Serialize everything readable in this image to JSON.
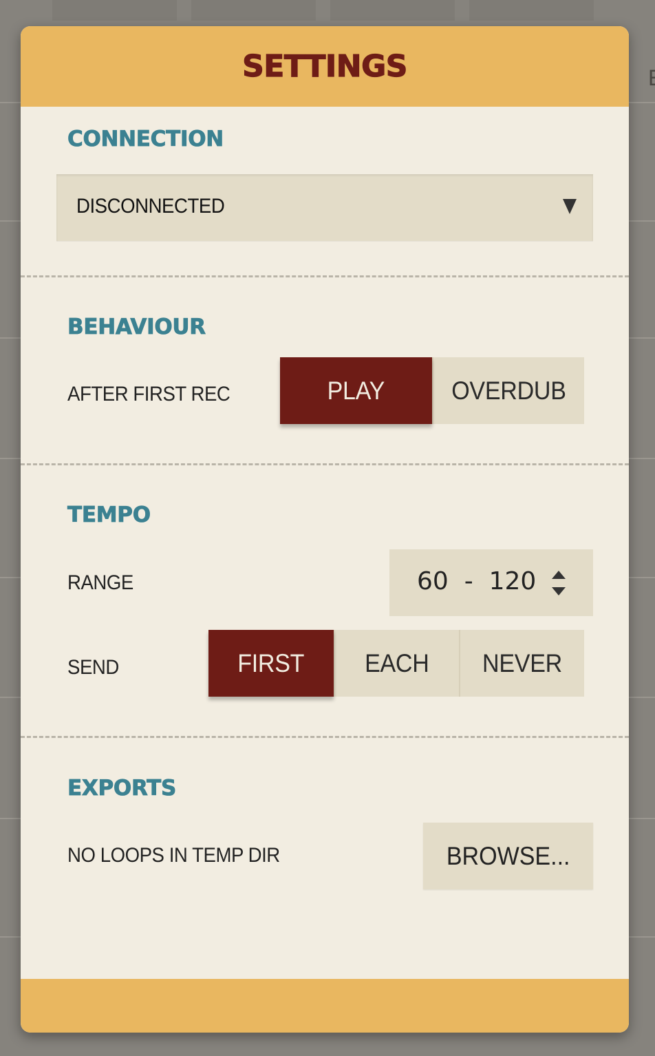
{
  "colors": {
    "header_bg": "#e9b760",
    "title": "#6e1c16",
    "section_title": "#3b8191",
    "panel_bg": "#f2ede1",
    "control_bg": "#e3dcc8",
    "active_bg": "#6e1c16"
  },
  "header": {
    "title": "SETTINGS"
  },
  "connection": {
    "section_title": "CONNECTION",
    "select_value": "DISCONNECTED",
    "caret_icon": "chevron-down-icon"
  },
  "behaviour": {
    "section_title": "BEHAVIOUR",
    "after_first_rec_label": "AFTER FIRST REC",
    "options": [
      "PLAY",
      "OVERDUB"
    ],
    "selected": "PLAY"
  },
  "tempo": {
    "section_title": "TEMPO",
    "range_label": "RANGE",
    "range_value": "60  -  120",
    "send_label": "SEND",
    "send_options": [
      "FIRST",
      "EACH",
      "NEVER"
    ],
    "send_selected": "FIRST"
  },
  "exports": {
    "section_title": "EXPORTS",
    "status_label": "NO LOOPS IN TEMP DIR",
    "browse_label": "BROWSE..."
  },
  "background": {
    "edge_text": "E"
  }
}
